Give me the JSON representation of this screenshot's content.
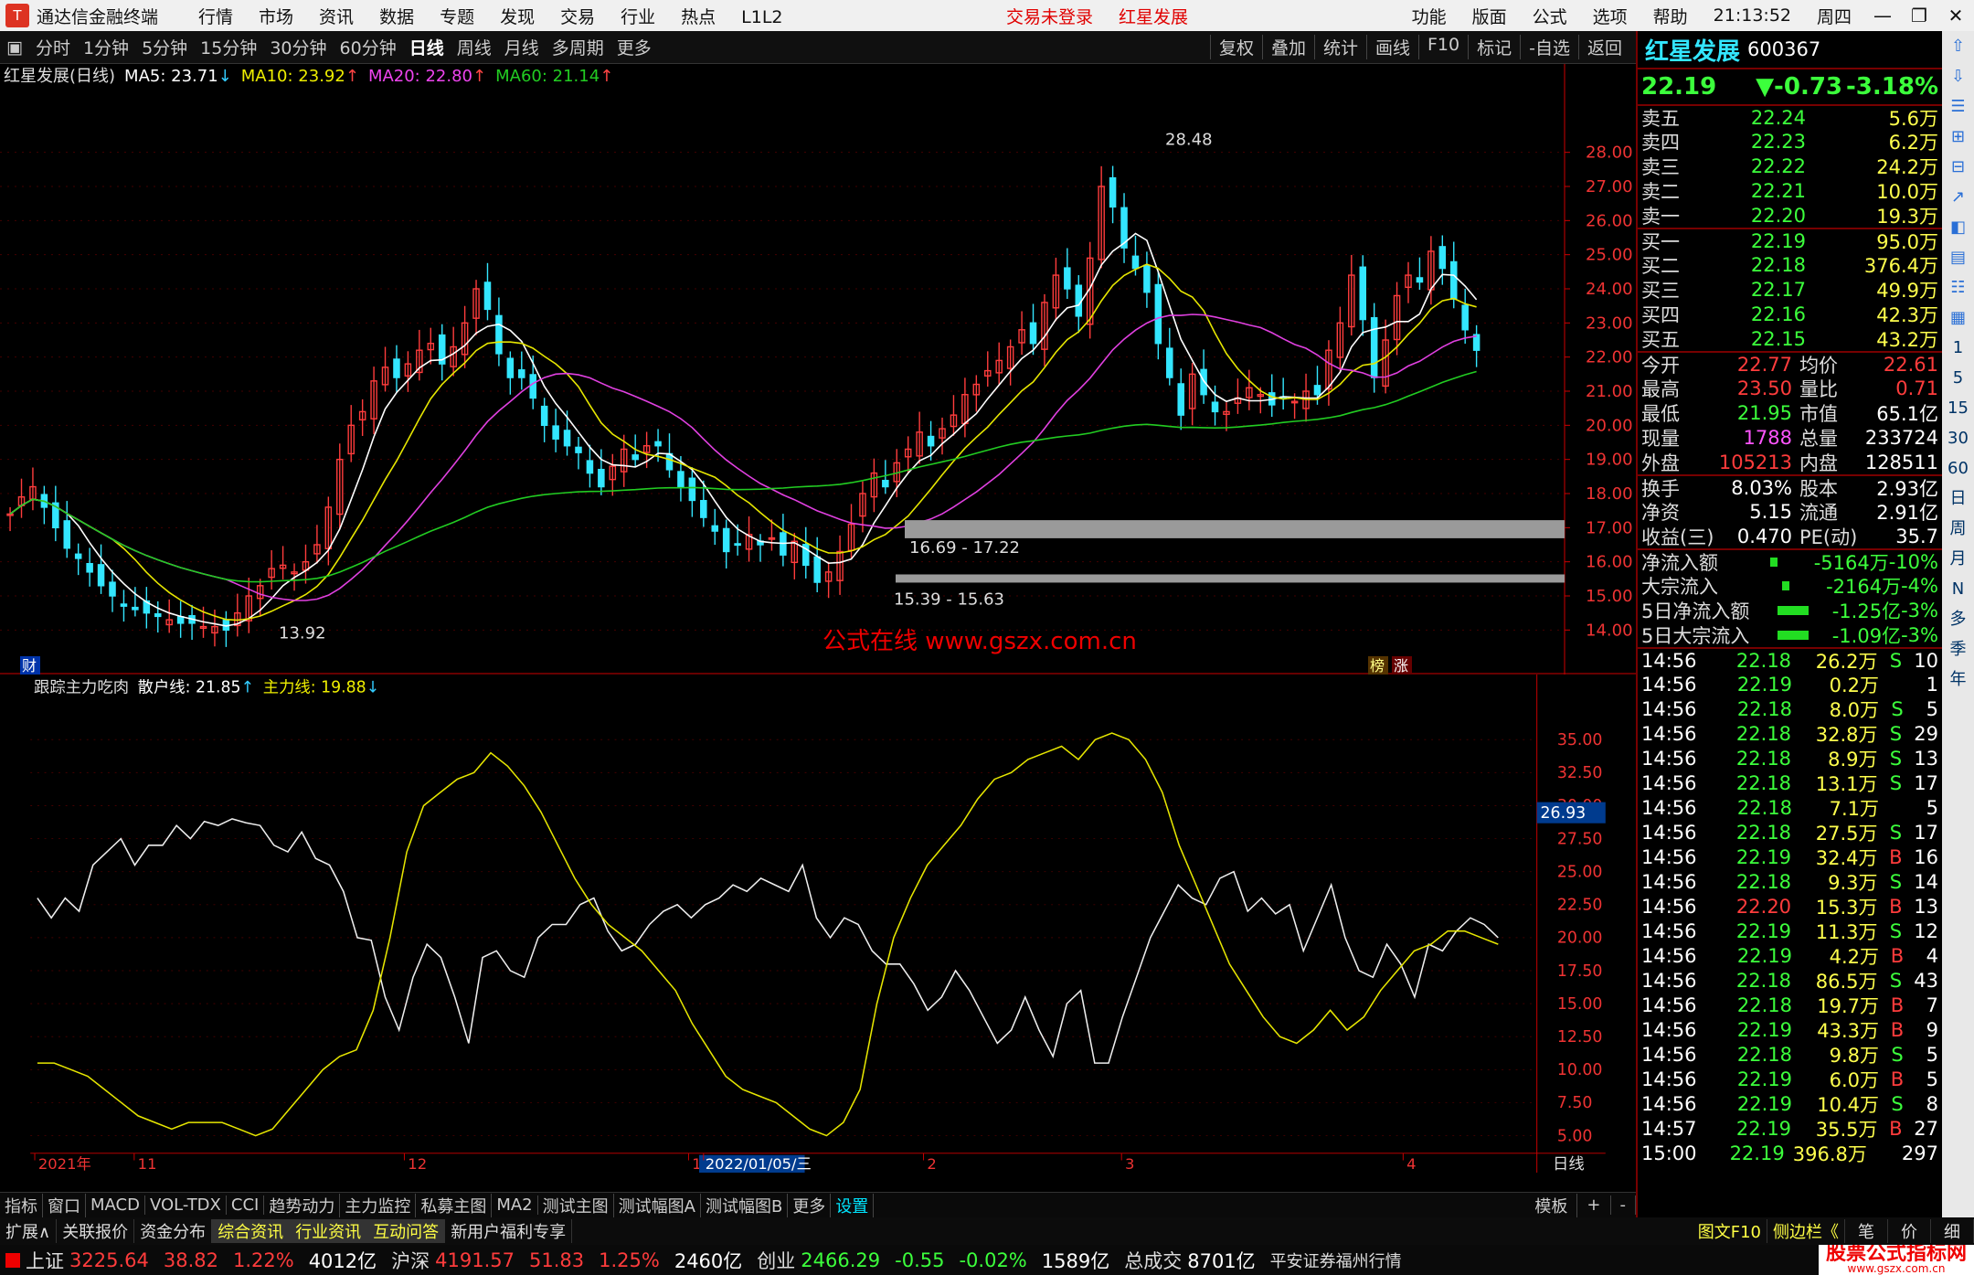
{
  "title_bar": {
    "app": "通达信金融终端",
    "menus": [
      "行情",
      "市场",
      "资讯",
      "数据",
      "专题",
      "发现",
      "交易",
      "行业",
      "热点",
      "L1L2"
    ],
    "status_red": [
      "交易未登录",
      "红星发展"
    ],
    "right_menus": [
      "功能",
      "版面",
      "公式",
      "选项",
      "帮助"
    ],
    "time": "21:13:52",
    "weekday": "周四"
  },
  "period_bar": {
    "periods": [
      "分时",
      "1分钟",
      "5分钟",
      "15分钟",
      "30分钟",
      "60分钟",
      "日线",
      "周线",
      "月线",
      "多周期",
      "更多"
    ],
    "selected": "日线",
    "tools": [
      "复权",
      "叠加",
      "统计",
      "画线",
      "F10",
      "标记",
      "-自选",
      "返回"
    ]
  },
  "main_chart": {
    "header": {
      "name": "红星发展(日线)",
      "ma5": "MA5: 23.71",
      "ma10": "MA10: 23.92",
      "ma20": "MA20: 22.80",
      "ma60": "MA60: 21.14",
      "ma5_dir": "↓",
      "ma10_dir": "↑",
      "ma20_dir": "↑",
      "ma60_dir": "↑"
    },
    "y_ticks": [
      "28.00",
      "27.00",
      "26.00",
      "25.00",
      "24.00",
      "23.00",
      "22.00",
      "21.00",
      "20.00",
      "19.00",
      "18.00",
      "17.00",
      "16.00",
      "15.00",
      "14.00"
    ],
    "high_label": "28.48",
    "low_label": "13.92",
    "zone1": "16.69 - 17.22",
    "zone2": "15.39 - 15.63",
    "watermark": "公式在线 www.gszx.com.cn",
    "tag_cai": "财",
    "tag_bang": "榜",
    "tag_zhang": "涨"
  },
  "sub_chart": {
    "header": {
      "name": "跟踪主力吃肉",
      "retail": "散户线: 21.85",
      "retail_dir": "↑",
      "main": "主力线: 19.88",
      "main_dir": "↓"
    },
    "y_ticks": [
      "35.00",
      "32.50",
      "30.00",
      "27.50",
      "25.00",
      "22.50",
      "20.00",
      "17.50",
      "15.00",
      "12.50",
      "10.00",
      "7.50",
      "5.00"
    ],
    "cursor_value": "26.93"
  },
  "x_axis": {
    "labels": [
      "2021年",
      "11",
      "12",
      "1",
      "2022/01/05/三",
      "2",
      "3",
      "4"
    ],
    "right": "日线"
  },
  "tabs": [
    "指标",
    "窗口",
    "MACD",
    "VOL-TDX",
    "CCI",
    "趋势动力",
    "主力监控",
    "私募主图",
    "MA2",
    "测试主图",
    "测试幅图A",
    "测试幅图B",
    "更多",
    "设置"
  ],
  "tabs_right": [
    "模板",
    "+",
    "-"
  ],
  "bottom_bar": [
    "扩展∧",
    "关联报价",
    "资金分布",
    "综合资讯",
    "行业资讯",
    "互动问答",
    "新用户福利专享"
  ],
  "bottom_right": [
    "图文F10",
    "侧边栏《",
    "笔",
    "价",
    "细"
  ],
  "status": {
    "sh": [
      "上证",
      "3225.64",
      "38.82",
      "1.22%",
      "4012亿"
    ],
    "sz": [
      "沪深",
      "4191.57",
      "51.83",
      "1.25%",
      "2460亿"
    ],
    "cy": [
      "创业",
      "2466.29",
      "-0.55",
      "-0.02%",
      "1589亿"
    ],
    "total": [
      "总成交",
      "8701亿"
    ],
    "broker": "平安证券福州行情",
    "brand": "股票公式指标网",
    "brand_url": "www.gszx.com.cn"
  },
  "quote": {
    "name": "红星发展",
    "code": "600367",
    "price": "22.19",
    "change": "▼-0.73",
    "pct": "-3.18%",
    "asks": [
      [
        "卖五",
        "22.24",
        "5.6万"
      ],
      [
        "卖四",
        "22.23",
        "6.2万"
      ],
      [
        "卖三",
        "22.22",
        "24.2万"
      ],
      [
        "卖二",
        "22.21",
        "10.0万"
      ],
      [
        "卖一",
        "22.20",
        "19.3万"
      ]
    ],
    "bids": [
      [
        "买一",
        "22.19",
        "95.0万"
      ],
      [
        "买二",
        "22.18",
        "376.4万"
      ],
      [
        "买三",
        "22.17",
        "49.9万"
      ],
      [
        "买四",
        "22.16",
        "42.3万"
      ],
      [
        "买五",
        "22.15",
        "43.2万"
      ]
    ],
    "stats1": [
      [
        "今开",
        "22.77",
        "均价",
        "22.61"
      ],
      [
        "最高",
        "23.50",
        "量比",
        "0.71"
      ],
      [
        "最低",
        "21.95",
        "市值",
        "65.1亿"
      ],
      [
        "现量",
        "1788",
        "总量",
        "233724"
      ],
      [
        "外盘",
        "105213",
        "内盘",
        "128511"
      ]
    ],
    "stats2": [
      [
        "换手",
        "8.03%",
        "股本",
        "2.93亿"
      ],
      [
        "净资",
        "5.15",
        "流通",
        "2.91亿"
      ],
      [
        "收益(三)",
        "0.470",
        "PE(动)",
        "35.7"
      ]
    ],
    "flows": [
      [
        "净流入额",
        "-5164万",
        "-10%"
      ],
      [
        "大宗流入",
        "-2164万",
        "-4%"
      ],
      [
        "5日净流入额",
        "-1.25亿",
        "-3%"
      ],
      [
        "5日大宗流入",
        "-1.09亿",
        "-3%"
      ]
    ],
    "ticks": [
      [
        "14:56",
        "22.18",
        "26.2万",
        "S",
        "10"
      ],
      [
        "14:56",
        "22.19",
        "0.2万",
        "",
        "1"
      ],
      [
        "14:56",
        "22.18",
        "8.0万",
        "S",
        "5"
      ],
      [
        "14:56",
        "22.18",
        "32.8万",
        "S",
        "29"
      ],
      [
        "14:56",
        "22.18",
        "8.9万",
        "S",
        "13"
      ],
      [
        "14:56",
        "22.18",
        "13.1万",
        "S",
        "17"
      ],
      [
        "14:56",
        "22.18",
        "7.1万",
        "",
        "5"
      ],
      [
        "14:56",
        "22.18",
        "27.5万",
        "S",
        "17"
      ],
      [
        "14:56",
        "22.19",
        "32.4万",
        "B",
        "16"
      ],
      [
        "14:56",
        "22.18",
        "9.3万",
        "S",
        "14"
      ],
      [
        "14:56",
        "22.20",
        "15.3万",
        "B",
        "13"
      ],
      [
        "14:56",
        "22.19",
        "11.3万",
        "S",
        "12"
      ],
      [
        "14:56",
        "22.19",
        "4.2万",
        "B",
        "4"
      ],
      [
        "14:56",
        "22.18",
        "86.5万",
        "S",
        "43"
      ],
      [
        "14:56",
        "22.18",
        "19.7万",
        "B",
        "7"
      ],
      [
        "14:56",
        "22.19",
        "43.3万",
        "B",
        "9"
      ],
      [
        "14:56",
        "22.18",
        "9.8万",
        "S",
        "5"
      ],
      [
        "14:56",
        "22.19",
        "6.0万",
        "B",
        "5"
      ],
      [
        "14:56",
        "22.19",
        "10.4万",
        "S",
        "8"
      ],
      [
        "14:57",
        "22.19",
        "35.5万",
        "B",
        "27"
      ],
      [
        "15:00",
        "22.19",
        "396.8万",
        "",
        "297"
      ]
    ]
  },
  "right_toolbar": [
    "1",
    "5",
    "15",
    "30",
    "60",
    "日",
    "周",
    "月",
    "N",
    "多",
    "季",
    "年"
  ],
  "colors": {
    "up": "#ff3c3c",
    "down": "#33e6ff",
    "ma5": "#ffffff",
    "ma10": "#e6e600",
    "ma20": "#e040e0",
    "ma60": "#22cc22"
  }
}
